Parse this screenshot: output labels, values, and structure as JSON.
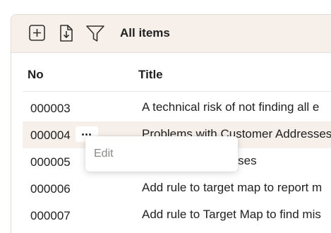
{
  "toolbar": {
    "icons": [
      "add-icon",
      "import-icon",
      "filter-icon"
    ],
    "view_title": "All items"
  },
  "table": {
    "columns": [
      "No",
      "Title"
    ],
    "rows": [
      {
        "no": "000003",
        "title": "A technical risk of not finding all e"
      },
      {
        "no": "000004",
        "title": "Problems with Customer Addresses",
        "selected": true
      },
      {
        "no": "000005",
        "title": "g addresses"
      },
      {
        "no": "000006",
        "title": "Add rule to target map to report m"
      },
      {
        "no": "000007",
        "title": "Add rule to Target Map to find mis"
      }
    ]
  },
  "row_menu": {
    "icon": "more-icon",
    "items": [
      "Edit"
    ]
  },
  "colors": {
    "toolbar_bg": "#f7f0ea",
    "selected_row_bg": "#f7f0ea",
    "text": "#212121",
    "disabled_text": "#8a8886"
  }
}
